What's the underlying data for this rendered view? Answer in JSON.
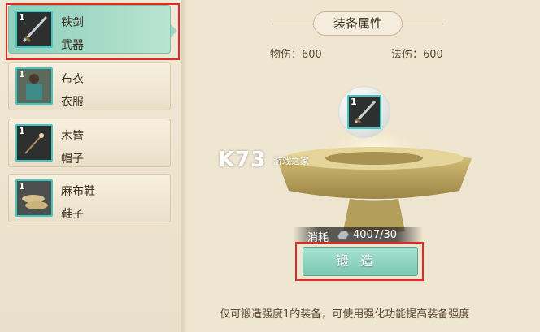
{
  "equipment_list": [
    {
      "level": "1",
      "name": "铁剑",
      "type": "武器",
      "icon": "iron-sword-icon",
      "selected": true
    },
    {
      "level": "1",
      "name": "布衣",
      "type": "衣服",
      "icon": "cloth-robe-icon",
      "selected": false
    },
    {
      "level": "1",
      "name": "木簪",
      "type": "帽子",
      "icon": "wooden-hairpin-icon",
      "selected": false
    },
    {
      "level": "1",
      "name": "麻布鞋",
      "type": "鞋子",
      "icon": "hemp-shoes-icon",
      "selected": false
    }
  ],
  "panel": {
    "title": "装备属性",
    "stats": [
      {
        "label": "物伤：600"
      },
      {
        "label": "法伤：600"
      }
    ],
    "preview_level": "1"
  },
  "watermark": {
    "main": "K73",
    "sub": "游戏之家"
  },
  "cost": {
    "label": "消耗",
    "value": "4007/30",
    "icon": "ore-icon"
  },
  "forge_button": {
    "label": "锻造"
  },
  "footer_tip": "仅可锻造强度1的装备，可使用强化功能提高装备强度",
  "colors": {
    "accent": "#8ed0bd",
    "highlight_box": "#e02b24",
    "frame": "#3bc9c4"
  }
}
